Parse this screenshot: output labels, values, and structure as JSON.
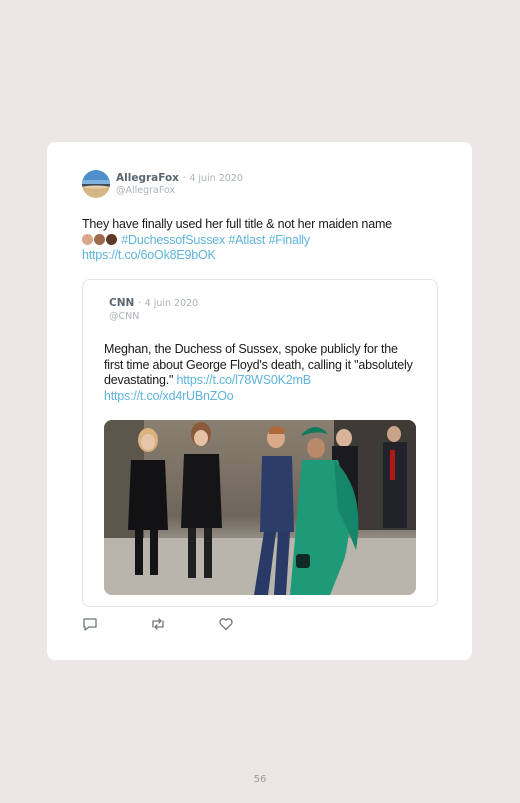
{
  "tweet": {
    "author_name": "AllegraFox",
    "separator": "·",
    "date": "4 juin 2020",
    "handle": "@AllegraFox",
    "text": "They have finally used her full title & not her maiden name",
    "hashtags": "#DuchessofSussex #Atlast #Finally",
    "link": "https://t.co/6oOk8E9bOK",
    "emoji_colors": [
      "#d8a88a",
      "#9c6b4e",
      "#5e3a26"
    ]
  },
  "quoted_tweet": {
    "author_name": "CNN",
    "separator": "·",
    "date": "4 juin 2020",
    "handle": "@CNN",
    "text": "Meghan, the Duchess of Sussex, spoke publicly for the first time about George Floyd's death, calling it \"absolutely devastating.\"",
    "link1": "https://t.co/l78WS0K2mB",
    "link2": "https://t.co/xd4rUBnZOo",
    "photo_icon": "photo-image"
  },
  "actions": {
    "icons": [
      "reply-icon",
      "retweet-icon",
      "like-icon"
    ]
  },
  "page_number": "56",
  "colors": {
    "background": "#ece6e6",
    "card": "#ffffff",
    "link": "#5eb4dd",
    "muted": "#aab1b8",
    "dress_green": "#1e9a78"
  }
}
